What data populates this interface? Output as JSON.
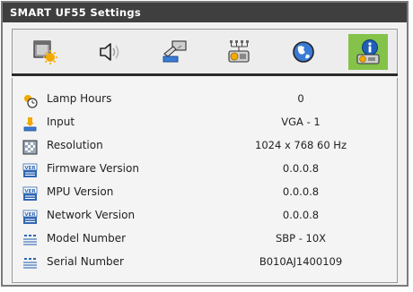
{
  "window": {
    "title": "SMART UF55 Settings"
  },
  "tabs": [
    {
      "icon": "projector-image-icon",
      "active": false
    },
    {
      "icon": "speaker-volume-icon",
      "active": false
    },
    {
      "icon": "remote-hand-icon",
      "active": false
    },
    {
      "icon": "network-projector-icon",
      "active": false
    },
    {
      "icon": "globe-language-icon",
      "active": false
    },
    {
      "icon": "info-projector-icon",
      "active": true
    }
  ],
  "rows": [
    {
      "icon": "lamp-hours-icon",
      "label": "Lamp Hours",
      "value": "0"
    },
    {
      "icon": "input-icon",
      "label": "Input",
      "value": "VGA - 1"
    },
    {
      "icon": "resolution-icon",
      "label": "Resolution",
      "value": "1024 x 768 60 Hz"
    },
    {
      "icon": "version-badge-icon",
      "label": "Firmware Version",
      "value": "0.0.0.8"
    },
    {
      "icon": "version-badge-icon",
      "label": "MPU Version",
      "value": "0.0.0.8"
    },
    {
      "icon": "version-badge-icon",
      "label": "Network Version",
      "value": "0.0.0.8"
    },
    {
      "icon": "model-number-icon",
      "label": "Model Number",
      "value": "SBP - 10X"
    },
    {
      "icon": "serial-number-icon",
      "label": "Serial Number",
      "value": "B010AJ1400109"
    }
  ],
  "colors": {
    "active_tab": "#84c24a",
    "title_bar": "#3f3f3f"
  }
}
